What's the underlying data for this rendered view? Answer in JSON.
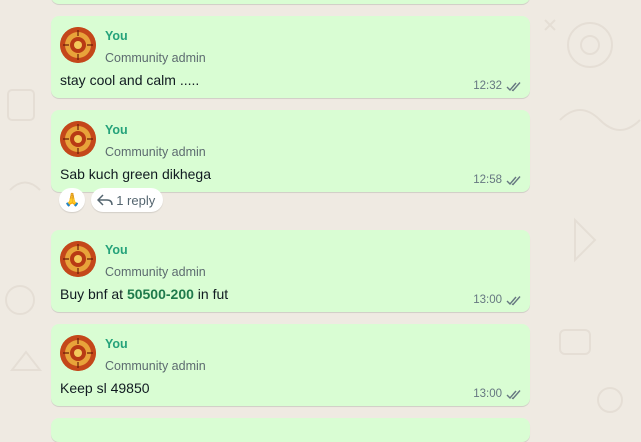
{
  "messages": [
    {
      "sender": "",
      "role": "",
      "text": "",
      "time": ""
    },
    {
      "sender": "You",
      "role": "Community admin",
      "text": "stay cool and calm .....",
      "time": "12:32"
    },
    {
      "sender": "You",
      "role": "Community admin",
      "text": "Sab kuch green dikhega",
      "time": "12:58"
    },
    {
      "sender": "You",
      "role": "Community admin",
      "text_prefix": "Buy bnf at ",
      "text_highlight": "50500-200",
      "text_suffix": " in fut",
      "time": "13:00"
    },
    {
      "sender": "You",
      "role": "Community admin",
      "text": "Keep sl 49850",
      "time": "13:00"
    }
  ],
  "reaction": {
    "emoji": "🙏",
    "reply_count_label": "1 reply"
  },
  "icons": {
    "read_receipt": "double-check-icon",
    "reply": "reply-arrow-icon",
    "avatar": "avatar-image"
  },
  "colors": {
    "bubble": "#d9fdd3",
    "sender": "#25a27a",
    "highlight": "#1f7a4c",
    "ticks": "#667781",
    "wallpaper": "#efeae2"
  }
}
